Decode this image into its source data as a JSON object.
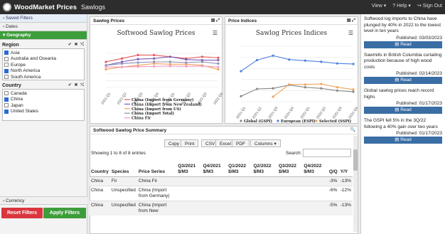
{
  "header": {
    "brand": "WoodMarket Prices",
    "page": "Sawlogs",
    "menu": [
      {
        "label": "View ▾",
        "icon": "eye-icon"
      },
      {
        "label": "? Help ▾",
        "icon": "help-icon"
      },
      {
        "label": "↪ Sign Out",
        "icon": "sign-out-icon"
      }
    ]
  },
  "sidebar": {
    "saved_filters": "› Saved Filters",
    "dates": "› Dates",
    "geography": "▾ Geography",
    "region": {
      "title": "Region",
      "tools": "✔ ✖ ⤭",
      "options": [
        {
          "label": "Asia",
          "checked": true
        },
        {
          "label": "Australia and Oceania",
          "checked": false
        },
        {
          "label": "Europe",
          "checked": false
        },
        {
          "label": "North America",
          "checked": true
        },
        {
          "label": "South America",
          "checked": false
        }
      ]
    },
    "country": {
      "title": "Country",
      "tools": "✔ ✖ ⤭",
      "options": [
        {
          "label": "Canada",
          "checked": false
        },
        {
          "label": "China",
          "checked": true
        },
        {
          "label": "Japan",
          "checked": false
        },
        {
          "label": "United States",
          "checked": true
        }
      ]
    },
    "currency": "› Currency",
    "reset": "Reset Filters",
    "apply": "Apply Filters"
  },
  "sawlog_panel": {
    "heading": "Sawlog Prices",
    "icons": "▤ ⤢",
    "legend_page": "1 / 2",
    "watermark": "WOOD RESOURCES INTERNATIONAL"
  },
  "indices_panel": {
    "heading": "Price Indices",
    "icons": "▤ ⤢",
    "watermark": "WOOD RESOURCES INTERNATIONAL"
  },
  "chart_data": [
    {
      "type": "line",
      "title": "Softwood Sawlog Prices",
      "categories": [
        "2021 Q1",
        "2021 Q2",
        "2021 Q3",
        "2021 Q4",
        "2022 Q1",
        "2022 Q2",
        "2022 Q3",
        "2022 Q4"
      ],
      "series": [
        {
          "name": "China (Import from Germany)",
          "color": "#e35a5a",
          "values": [
            7.5,
            8.5,
            9.5,
            9.5,
            9.0,
            8.5,
            9.0,
            8.7
          ]
        },
        {
          "name": "China (Import from New Zealand)",
          "color": "#7b5fb8",
          "values": [
            6.5,
            7.5,
            8.3,
            8.5,
            9.0,
            8.2,
            8.0,
            8.0
          ]
        },
        {
          "name": "China (Import from US)",
          "color": "#f0a35e",
          "values": [
            5.3,
            6.0,
            6.5,
            7.0,
            6.8,
            6.8,
            6.5,
            5.3
          ]
        },
        {
          "name": "China (Import Total)",
          "color": "#8a8fb8",
          "values": [
            6.5,
            7.0,
            7.3,
            7.5,
            7.5,
            7.3,
            7.5,
            7.0
          ]
        },
        {
          "name": "China Fir",
          "color": "#f29ac0",
          "values": [
            6.0,
            6.0,
            6.1,
            6.2,
            6.3,
            6.2,
            6.3,
            6.0
          ]
        }
      ],
      "ylim": [
        0,
        10
      ]
    },
    {
      "type": "line",
      "title": "Sawlog Prices Indices",
      "categories": [
        "2021 Q1",
        "2021 Q2",
        "2021 Q3",
        "2021 Q4",
        "2022 Q1",
        "2022 Q2",
        "2022 Q3",
        "2022 Q4"
      ],
      "series": [
        {
          "name": "Global (GSPI)",
          "color": "#888888",
          "values": [
            1.0,
            2.3,
            2.4,
            3.0,
            2.6,
            2.4,
            2.0,
            1.8
          ]
        },
        {
          "name": "European (ESPI)",
          "color": "#4f7fe0",
          "values": [
            5.5,
            7.5,
            8.3,
            7.6,
            7.4,
            7.2,
            6.9,
            6.8
          ]
        },
        {
          "name": "Selected (SSPI)",
          "color": "#f0a35e",
          "values": [
            null,
            null,
            0.9,
            3.1,
            3.1,
            3.2,
            2.6,
            2.2
          ]
        }
      ],
      "ylim": [
        0,
        10
      ]
    }
  ],
  "summary": {
    "heading": "Softwood Sawlog Price Summary",
    "buttons": {
      "copy": "Copy",
      "print": "Print",
      "csv": "CSV",
      "excel": "Excel",
      "pdf": "PDF",
      "columns": "Columns ▾"
    },
    "entries_info": "Showing 1 to 8 of 8 entries",
    "search_label": "Search:",
    "search_value": "",
    "columns": [
      "Country",
      "Species",
      "Price Series",
      "Q3/2021 $/M3",
      "Q4/2021 $/M3",
      "Q1/2022 $/M3",
      "Q2/2022 $/M3",
      "Q3/2022 $/M3",
      "Q4/2022 $/M3",
      "Q/Q",
      "Y/Y"
    ],
    "rows": [
      {
        "country": "China",
        "species": "Fir",
        "series": "China Fir",
        "qq": "-3%",
        "yy": "-13%"
      },
      {
        "country": "China",
        "species": "Unspecified",
        "series": "China (Import from Germany)",
        "qq": "-6%",
        "yy": "-12%"
      },
      {
        "country": "China",
        "species": "Unspecified",
        "series": "China (Import from New",
        "qq": "-5%",
        "yy": "-13%"
      }
    ]
  },
  "news": [
    {
      "text": "Softwood log imports to China have plunged by 40% in 2022 to the lowest level in ten years",
      "date": "Published: 03/03/2023",
      "button": "Read"
    },
    {
      "text": "Sawmills in British Columbia curtailing production because of high wood costs",
      "date": "Published: 02/14/2023",
      "button": "Read"
    },
    {
      "text": "Global sawlog prices reach record highs",
      "date": "Published: 01/17/2023",
      "button": "Read"
    },
    {
      "text": "The GSPI fell 5% in the 3Q/22 following a 40% gain over two years",
      "date": "Published: 01/17/2023",
      "button": "Read"
    }
  ]
}
